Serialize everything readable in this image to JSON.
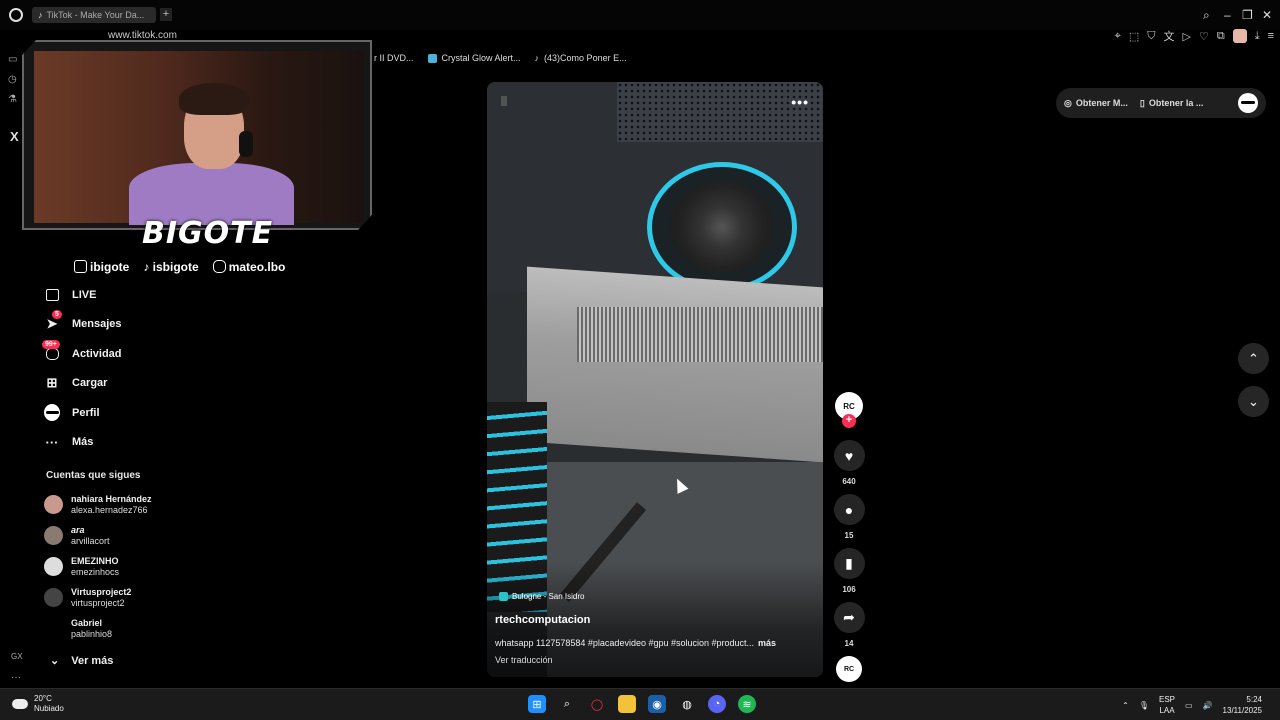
{
  "browser": {
    "tab_title": "TikTok - Make Your Da...",
    "new_tab": "+",
    "url": "www.tiktok.com",
    "bookmarks": [
      "r II DVD...",
      "Crystal Glow Alert...",
      "(43)Como Poner E..."
    ]
  },
  "stream_overlay": {
    "brand": "BIGOTE",
    "socials": [
      "ibigote",
      "isbigote",
      "mateo.lbo"
    ]
  },
  "sidebar": {
    "items": [
      {
        "label": "LIVE",
        "icon": "live-icon"
      },
      {
        "label": "Mensajes",
        "icon": "messages-icon",
        "badge": "5"
      },
      {
        "label": "Actividad",
        "icon": "activity-icon",
        "badge": "99+"
      },
      {
        "label": "Cargar",
        "icon": "upload-icon"
      },
      {
        "label": "Perfil",
        "icon": "profile-icon"
      },
      {
        "label": "Más",
        "icon": "more-icon"
      }
    ],
    "following_title": "Cuentas que sigues",
    "following": [
      {
        "name": "nahiara Hernández",
        "user": "alexa.hernadez766"
      },
      {
        "name": "ara",
        "user": "arvillacort"
      },
      {
        "name": "EMEZINHO",
        "user": "emezinhocs"
      },
      {
        "name": "Virtusproject2",
        "user": "virtusproject2"
      },
      {
        "name": "Gabriel",
        "user": "pablinhio8"
      }
    ],
    "see_more": "Ver más",
    "gx": "GX",
    "more_dots": "···"
  },
  "video": {
    "location": "Bulogne - San Isidro",
    "author": "rtechcomputacion",
    "description": "whatsapp 1127578584 #placadevideo #gpu #solucion #product...",
    "more": "más",
    "translate": "Ver traducción",
    "menu": "•••"
  },
  "actions": {
    "creator_initials": "RC",
    "likes": "640",
    "comments": "15",
    "saves": "106",
    "shares": "14"
  },
  "top_pill": {
    "item1": "Obtener M...",
    "item2": "Obtener la ..."
  },
  "taskbar": {
    "temp": "20°C",
    "weather": "Nubiado",
    "lang1": "ESP",
    "lang2": "LAA",
    "time": "5:24",
    "date": "13/11/2025"
  },
  "colors": {
    "accent": "#fe2c55",
    "cyan": "#2ec9e8"
  }
}
